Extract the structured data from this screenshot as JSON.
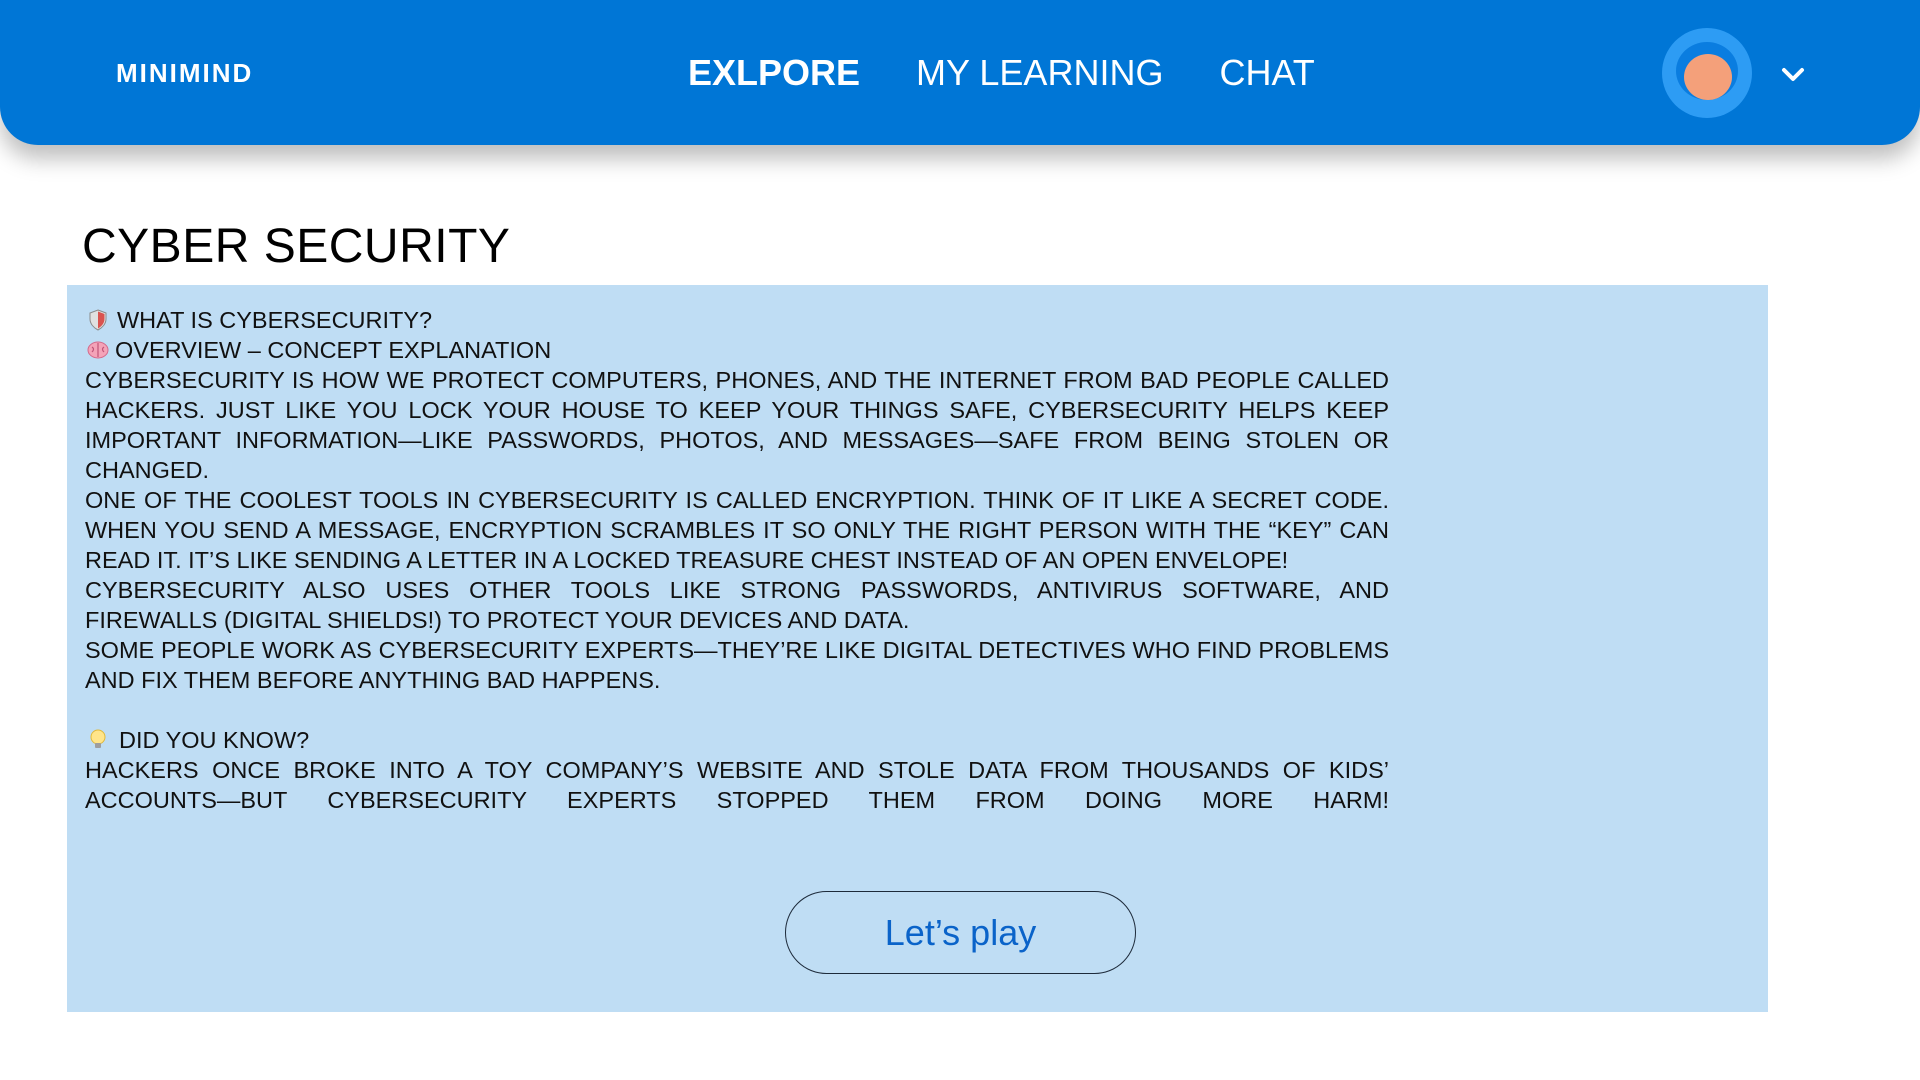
{
  "header": {
    "brand": "MINIMIND",
    "nav": [
      {
        "label": "EXLPORE",
        "active": true
      },
      {
        "label": "MY LEARNING",
        "active": false
      },
      {
        "label": "CHAT",
        "active": false
      }
    ],
    "avatar_icon": "user-avatar",
    "menu_icon": "chevron-down-icon"
  },
  "main": {
    "title": "CYBER SECURITY",
    "what_is": {
      "icon": "shield-icon",
      "text": "WHAT IS CYBERSECURITY?"
    },
    "overview": {
      "icon": "brain-icon",
      "text": "OVERVIEW – CONCEPT EXPLANATION"
    },
    "paragraphs": [
      "CYBERSECURITY IS HOW WE PROTECT COMPUTERS, PHONES, AND THE INTERNET FROM BAD PEOPLE CALLED HACKERS. JUST LIKE YOU LOCK YOUR HOUSE TO KEEP YOUR THINGS SAFE, CYBERSECURITY HELPS KEEP IMPORTANT INFORMATION—LIKE PASSWORDS, PHOTOS, AND MESSAGES—SAFE FROM BEING STOLEN OR CHANGED.",
      "ONE OF THE COOLEST TOOLS IN CYBERSECURITY IS CALLED ENCRYPTION. THINK OF IT LIKE A SECRET CODE. WHEN YOU SEND A MESSAGE, ENCRYPTION SCRAMBLES IT SO ONLY THE RIGHT PERSON WITH THE “KEY” CAN READ IT. IT’S LIKE SENDING A LETTER IN A LOCKED TREASURE CHEST INSTEAD OF AN OPEN ENVELOPE!",
      "CYBERSECURITY ALSO USES OTHER TOOLS LIKE STRONG PASSWORDS, ANTIVIRUS SOFTWARE, AND FIREWALLS (DIGITAL SHIELDS!) TO PROTECT YOUR DEVICES AND DATA.",
      "SOME PEOPLE WORK AS CYBERSECURITY EXPERTS—THEY’RE LIKE DIGITAL DETECTIVES WHO FIND PROBLEMS AND FIX THEM BEFORE ANYTHING BAD HAPPENS."
    ],
    "did_you_know": {
      "icon": "lightbulb-icon",
      "heading": "DID YOU KNOW?",
      "text": "HACKERS ONCE BROKE INTO A TOY COMPANY’S WEBSITE AND STOLE DATA FROM THOUSANDS OF KIDS’ ACCOUNTS—BUT CYBERSECURITY EXPERTS STOPPED THEM FROM DOING MORE HARM!"
    },
    "play_button": "Let’s play"
  },
  "colors": {
    "header_bg": "#0076d6",
    "panel_bg": "#bfddf4",
    "button_text": "#0a63c9"
  }
}
